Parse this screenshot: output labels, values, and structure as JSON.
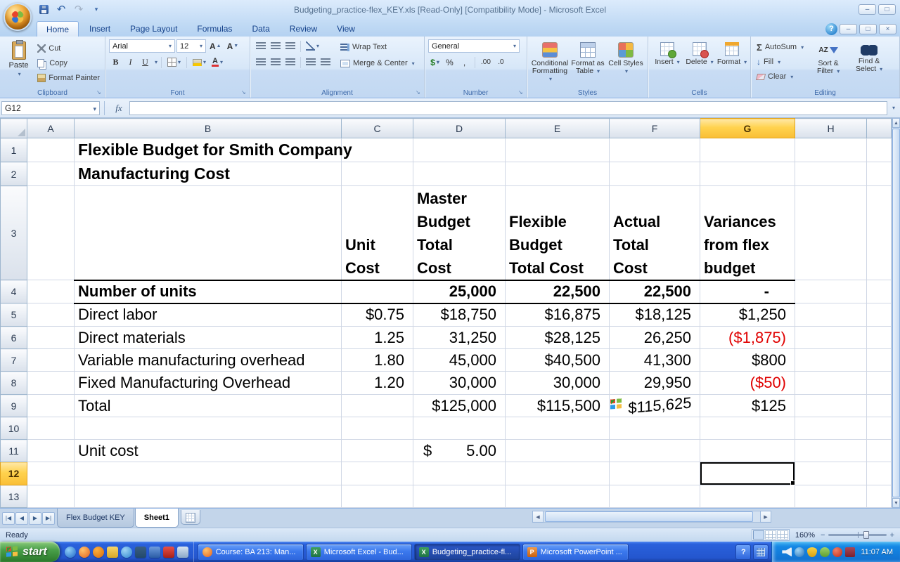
{
  "window": {
    "title": "Budgeting_practice-flex_KEY.xls  [Read-Only]  [Compatibility Mode] - Microsoft Excel"
  },
  "ribbon": {
    "tabs": [
      "Home",
      "Insert",
      "Page Layout",
      "Formulas",
      "Data",
      "Review",
      "View"
    ],
    "active_tab": "Home",
    "clipboard": {
      "group": "Clipboard",
      "paste": "Paste",
      "cut": "Cut",
      "copy": "Copy",
      "format_painter": "Format Painter"
    },
    "font": {
      "group": "Font",
      "family": "Arial",
      "size": "12",
      "bold": "B",
      "italic": "I",
      "underline": "U"
    },
    "alignment": {
      "group": "Alignment",
      "wrap_text": "Wrap Text",
      "merge_center": "Merge & Center"
    },
    "number": {
      "group": "Number",
      "format": "General",
      "currency": "$",
      "percent": "%",
      "comma": ",",
      "inc_decimal": ".00",
      "dec_decimal": ".0"
    },
    "styles": {
      "group": "Styles",
      "conditional": "Conditional Formatting",
      "format_table": "Format as Table",
      "cell_styles": "Cell Styles"
    },
    "cells": {
      "group": "Cells",
      "insert": "Insert",
      "delete": "Delete",
      "format": "Format"
    },
    "editing": {
      "group": "Editing",
      "autosum": "AutoSum",
      "fill": "Fill",
      "clear": "Clear",
      "sort_filter": "Sort & Filter",
      "find_select": "Find & Select"
    }
  },
  "formula_bar": {
    "name_box": "G12",
    "formula": ""
  },
  "grid": {
    "columns": [
      "A",
      "B",
      "C",
      "D",
      "E",
      "F",
      "G",
      "H"
    ],
    "selected_column": "G",
    "selected_row": "12",
    "selected_cell": "G12",
    "rows": [
      {
        "n": "1",
        "cells": [
          {
            "col": "B",
            "text": "Flexible Budget for Smith Company",
            "cls": "doc-title"
          }
        ]
      },
      {
        "n": "2",
        "cells": [
          {
            "col": "B",
            "text": "Manufacturing Cost",
            "cls": "doc-title"
          }
        ]
      },
      {
        "n": "3",
        "cells": [
          {
            "col": "C",
            "cls": "col-head",
            "lines": [
              "Unit",
              "Cost"
            ]
          },
          {
            "col": "D",
            "cls": "col-head",
            "lines": [
              "Master",
              "Budget",
              "Total",
              "Cost"
            ]
          },
          {
            "col": "E",
            "cls": "col-head",
            "lines": [
              "Flexible",
              "Budget",
              "Total Cost"
            ]
          },
          {
            "col": "F",
            "cls": "col-head",
            "lines": [
              "Actual",
              "Total",
              "Cost"
            ]
          },
          {
            "col": "G",
            "cls": "col-head",
            "lines": [
              "Variances",
              "from flex",
              "budget"
            ]
          }
        ]
      },
      {
        "n": "4",
        "cells": [
          {
            "col": "B",
            "text": "Number of units",
            "cls": "b rule"
          },
          {
            "col": "C",
            "text": "",
            "cls": "rule"
          },
          {
            "col": "D",
            "text": "25,000",
            "cls": "b num rule"
          },
          {
            "col": "E",
            "text": "22,500",
            "cls": "b num rule"
          },
          {
            "col": "F",
            "text": "22,500",
            "cls": "b num rule"
          },
          {
            "col": "G",
            "text": "-",
            "cls": "b num rule dash"
          }
        ]
      },
      {
        "n": "5",
        "cells": [
          {
            "col": "B",
            "text": "Direct labor"
          },
          {
            "col": "C",
            "text": "$0.75",
            "cls": "num"
          },
          {
            "col": "D",
            "text": "$18,750",
            "cls": "num"
          },
          {
            "col": "E",
            "text": "$16,875",
            "cls": "num"
          },
          {
            "col": "F",
            "text": "$18,125",
            "cls": "num"
          },
          {
            "col": "G",
            "text": "$1,250",
            "cls": "num"
          }
        ]
      },
      {
        "n": "6",
        "cells": [
          {
            "col": "B",
            "text": "Direct materials"
          },
          {
            "col": "C",
            "text": "1.25",
            "cls": "num"
          },
          {
            "col": "D",
            "text": "31,250",
            "cls": "num"
          },
          {
            "col": "E",
            "text": "$28,125",
            "cls": "num"
          },
          {
            "col": "F",
            "text": "26,250",
            "cls": "num"
          },
          {
            "col": "G",
            "text": "($1,875)",
            "cls": "num red"
          }
        ]
      },
      {
        "n": "7",
        "cells": [
          {
            "col": "B",
            "text": "Variable manufacturing overhead"
          },
          {
            "col": "C",
            "text": "1.80",
            "cls": "num"
          },
          {
            "col": "D",
            "text": "45,000",
            "cls": "num"
          },
          {
            "col": "E",
            "text": "$40,500",
            "cls": "num"
          },
          {
            "col": "F",
            "text": "41,300",
            "cls": "num"
          },
          {
            "col": "G",
            "text": "$800",
            "cls": "num"
          }
        ]
      },
      {
        "n": "8",
        "cells": [
          {
            "col": "B",
            "text": "Fixed Manufacturing Overhead"
          },
          {
            "col": "C",
            "text": "1.20",
            "cls": "num"
          },
          {
            "col": "D",
            "text": "30,000",
            "cls": "num"
          },
          {
            "col": "E",
            "text": "30,000",
            "cls": "num"
          },
          {
            "col": "F",
            "text": "29,950",
            "cls": "num"
          },
          {
            "col": "G",
            "text": "($50)",
            "cls": "num red"
          }
        ]
      },
      {
        "n": "9",
        "cells": [
          {
            "col": "B",
            "text": "Total"
          },
          {
            "col": "D",
            "text": "$125,000",
            "cls": "num"
          },
          {
            "col": "E",
            "text": "$115,500",
            "cls": "num"
          },
          {
            "col": "F",
            "text": "$115,625",
            "cls": "num flag"
          },
          {
            "col": "G",
            "text": "$125",
            "cls": "num"
          }
        ]
      },
      {
        "n": "10",
        "cells": []
      },
      {
        "n": "11",
        "cells": [
          {
            "col": "B",
            "text": "Unit cost"
          },
          {
            "col": "D",
            "acct": {
              "sym": "$",
              "val": "5.00"
            }
          }
        ]
      },
      {
        "n": "12",
        "selected": true,
        "cells": [
          {
            "col": "G",
            "text": "",
            "cls": "sel-cell"
          }
        ]
      },
      {
        "n": "13",
        "cells": []
      }
    ]
  },
  "sheet_tabs": {
    "tabs": [
      {
        "label": "Flex Budget KEY",
        "active": false
      },
      {
        "label": "Sheet1",
        "active": true
      }
    ]
  },
  "status_bar": {
    "ready": "Ready",
    "zoom": "160%"
  },
  "taskbar": {
    "start_label": "start",
    "quick_launch": [
      "internet-explorer",
      "firefox",
      "media-player",
      "outlook",
      "messenger",
      "photoshop",
      "word",
      "acrobat",
      "show-desktop"
    ],
    "tasks": [
      {
        "label": "Course: BA 213: Man...",
        "icon": "firefox",
        "active": false
      },
      {
        "label": "Microsoft Excel - Bud...",
        "icon": "excel",
        "active": false
      },
      {
        "label": "Budgeting_practice-fl...",
        "icon": "excel",
        "active": true
      },
      {
        "label": "Microsoft PowerPoint ...",
        "icon": "powerpoint",
        "active": false
      }
    ],
    "tray_icons": [
      "volume",
      "network",
      "antivirus",
      "messenger",
      "update",
      "word"
    ],
    "clock": "11:07 AM"
  }
}
